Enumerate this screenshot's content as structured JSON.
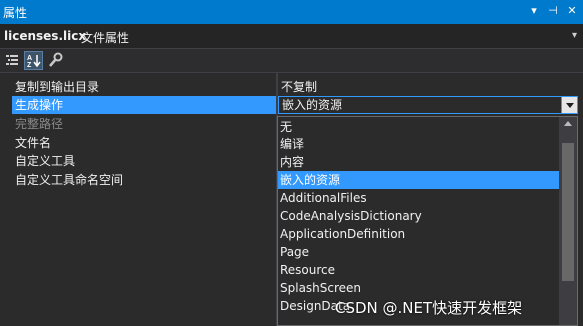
{
  "window": {
    "title": "属性",
    "controls": {
      "dropdown": "▾",
      "pin": "⊣",
      "close": "✕"
    }
  },
  "subject": {
    "name": "licenses.licx",
    "type": "文件属性",
    "dropdown_glyph": "▾"
  },
  "toolbar": {
    "buttons": [
      "categorized-icon",
      "alphabetical-icon",
      "property-pages-icon"
    ]
  },
  "properties": [
    {
      "label": "复制到输出目录",
      "value": "不复制",
      "state": "normal"
    },
    {
      "label": "生成操作",
      "value": "嵌入的资源",
      "state": "selected"
    },
    {
      "label": "完整路径",
      "value": "",
      "state": "disabled"
    },
    {
      "label": "文件名",
      "value": "",
      "state": "normal"
    },
    {
      "label": "自定义工具",
      "value": "",
      "state": "normal"
    },
    {
      "label": "自定义工具命名空间",
      "value": "",
      "state": "normal"
    }
  ],
  "dropdown": {
    "options": [
      "无",
      "编译",
      "内容",
      "嵌入的资源",
      "AdditionalFiles",
      "CodeAnalysisDictionary",
      "ApplicationDefinition",
      "Page",
      "Resource",
      "SplashScreen",
      "DesignData"
    ],
    "highlighted": "嵌入的资源"
  },
  "watermark": "CSDN @.NET快速开发框架",
  "colors": {
    "accent": "#007acc",
    "selection": "#3399ff",
    "background": "#2b2b2b"
  }
}
